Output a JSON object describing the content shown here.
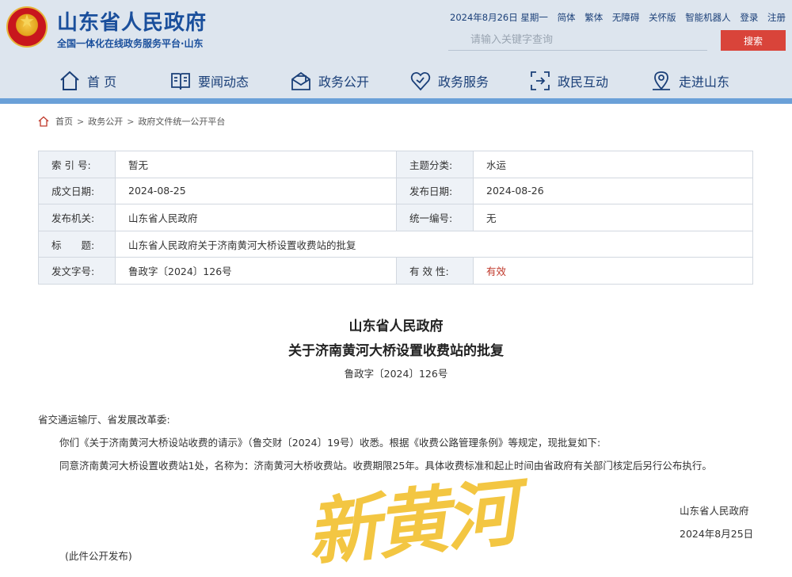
{
  "header": {
    "site_title": "山东省人民政府",
    "site_subtitle": "全国一体化在线政务服务平台·山东",
    "date": "2024年8月26日 星期一",
    "top_links": [
      "简体",
      "繁体",
      "无障碍",
      "关怀版",
      "智能机器人",
      "登录",
      "注册"
    ],
    "search_placeholder": "请输入关键字查询",
    "search_button": "搜索"
  },
  "nav": [
    {
      "label": "首 页",
      "icon": "home-icon"
    },
    {
      "label": "要闻动态",
      "icon": "book-icon"
    },
    {
      "label": "政务公开",
      "icon": "mail-icon"
    },
    {
      "label": "政务服务",
      "icon": "heart-icon"
    },
    {
      "label": "政民互动",
      "icon": "interaction-icon"
    },
    {
      "label": "走进山东",
      "icon": "map-pin-icon"
    }
  ],
  "breadcrumb": [
    "首页",
    "政务公开",
    "政府文件统一公开平台"
  ],
  "info_table": {
    "index_key": "索 引 号:",
    "index_val": "暂无",
    "topic_key": "主题分类:",
    "topic_val": "水运",
    "made_key": "成文日期:",
    "made_val": "2024-08-25",
    "pub_key": "发布日期:",
    "pub_val": "2024-08-26",
    "org_key": "发布机关:",
    "org_val": "山东省人民政府",
    "uni_key": "统一编号:",
    "uni_val": "无",
    "title_key": "标　　题:",
    "title_val": "山东省人民政府关于济南黄河大桥设置收费站的批复",
    "docno_key": "发文字号:",
    "docno_val": "鲁政字〔2024〕126号",
    "valid_key": "有 效 性:",
    "valid_val": "有效"
  },
  "document": {
    "title_line1": "山东省人民政府",
    "title_line2": "关于济南黄河大桥设置收费站的批复",
    "number": "鲁政字〔2024〕126号",
    "salutation": "省交通运输厅、省发展改革委:",
    "para1": "你们《关于济南黄河大桥设站收费的请示》（鲁交财〔2024〕19号）收悉。根据《收费公路管理条例》等规定，现批复如下:",
    "para2": "同意济南黄河大桥设置收费站1处，名称为：济南黄河大桥收费站。收费期限25年。具体收费标准和起止时间由省政府有关部门核定后另行公布执行。",
    "signer": "山东省人民政府",
    "sign_date": "2024年8月25日",
    "note": "(此件公开发布)"
  },
  "watermark": "新黄河"
}
